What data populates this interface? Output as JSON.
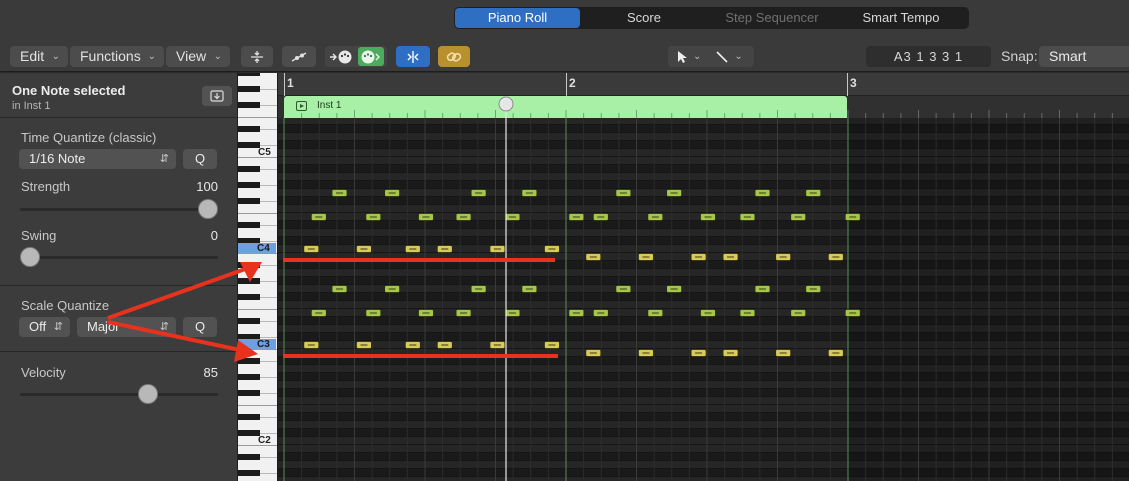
{
  "tabs": [
    {
      "label": "Piano Roll",
      "state": "active"
    },
    {
      "label": "Score",
      "state": "normal"
    },
    {
      "label": "Step Sequencer",
      "state": "disabled"
    },
    {
      "label": "Smart Tempo",
      "state": "normal"
    }
  ],
  "toolbar": {
    "edit_label": "Edit",
    "functions_label": "Functions",
    "view_label": "View",
    "position_display": "A3   1 3 3 1",
    "snap_label": "Snap:",
    "snap_value": "Smart"
  },
  "icons": {
    "collapse": "collapse-icon",
    "automation": "automation-curve-icon",
    "midi_in": "midi-in-icon",
    "midi_out": "midi-out-icon",
    "catch": "catch-playhead-icon",
    "link": "link-icon",
    "pointer_tool": "pointer-tool-icon",
    "pencil_tool": "pencil-tool-icon"
  },
  "inspector": {
    "selection_title": "One Note selected",
    "selection_subtitle": "in Inst 1",
    "time_quantize": {
      "label": "Time Quantize (classic)",
      "value": "1/16 Note",
      "q_label": "Q",
      "strength_label": "Strength",
      "strength_value": "100",
      "swing_label": "Swing",
      "swing_value": "0"
    },
    "scale_quantize": {
      "label": "Scale Quantize",
      "mode_value": "Off",
      "scale_value": "Major",
      "q_label": "Q"
    },
    "velocity": {
      "label": "Velocity",
      "value": "85"
    }
  },
  "keyboard_labels": [
    "C5",
    "C4",
    "C3",
    "C2"
  ],
  "ruler": {
    "bars": [
      "1",
      "2",
      "3"
    ]
  },
  "region": {
    "name": "Inst 1"
  },
  "colors": {
    "accent": "#2f6fc3",
    "region": "#a7f0a6",
    "note_green": "#a4c64b",
    "note_yellow": "#d7c95a",
    "annotation": "#e8321e",
    "key_highlight": "#6da0e0"
  }
}
